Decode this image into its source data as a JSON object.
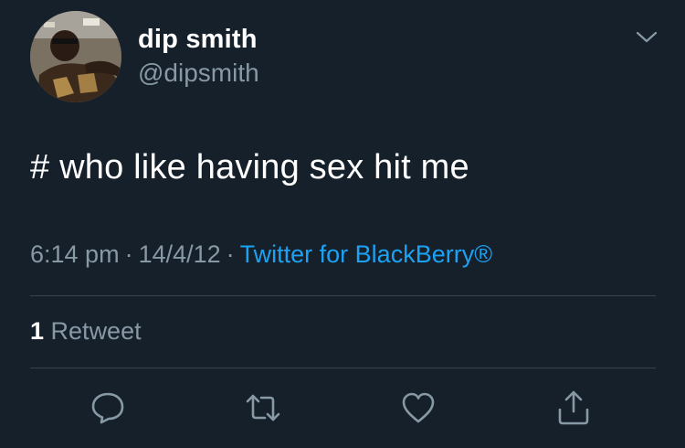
{
  "colors": {
    "background": "#15202b",
    "primary_text": "#ffffff",
    "secondary_text": "#8899a6",
    "link": "#1da1f2",
    "divider": "#38444d"
  },
  "user": {
    "display_name": "dip smith",
    "handle": "@dipsmith",
    "avatar_icon": "user-avatar-photo"
  },
  "tweet": {
    "text": "# who like having sex hit me",
    "time": "6:14 pm",
    "date": "14/4/12",
    "separator": "·",
    "source": "Twitter for BlackBerry®"
  },
  "stats": {
    "retweet_count": "1",
    "retweet_label": "Retweet"
  },
  "actions": [
    {
      "icon": "reply-icon"
    },
    {
      "icon": "retweet-icon"
    },
    {
      "icon": "like-icon"
    },
    {
      "icon": "share-icon"
    }
  ],
  "menu_icon": "chevron-down-icon"
}
